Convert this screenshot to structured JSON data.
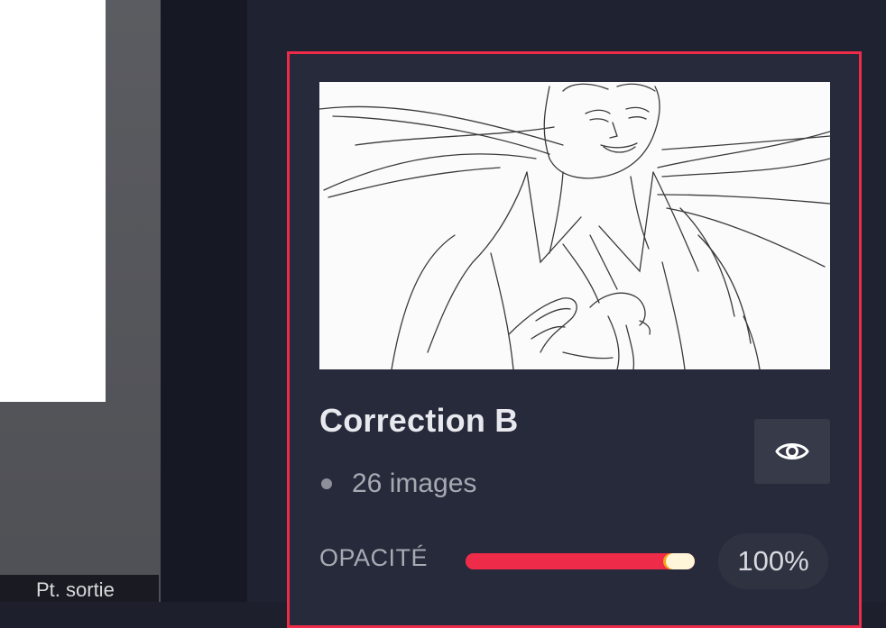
{
  "left": {
    "output_label": "Pt. sortie"
  },
  "layer_card": {
    "name": "Correction B",
    "image_count": "26 images",
    "visibility_icon": "eye-icon",
    "opacity_label": "OPACITÉ",
    "opacity_value": "100%",
    "opacity_level": 1.0
  },
  "colors": {
    "accent": "#ee2b48",
    "panel_bg": "#1f2231",
    "card_bg": "#262a3b",
    "knob_highlight": "#f4a41c"
  }
}
